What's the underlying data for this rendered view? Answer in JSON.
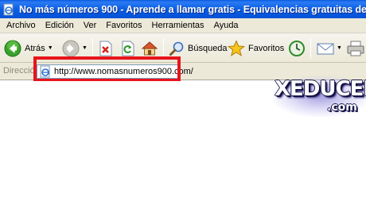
{
  "window": {
    "title": "No más números 900 - Aprende a llamar gratis - Equivalencias gratuitas de teléfo",
    "icon": "ie-page-icon"
  },
  "menu": {
    "items": [
      "Archivo",
      "Edición",
      "Ver",
      "Favoritos",
      "Herramientas",
      "Ayuda"
    ]
  },
  "toolbar": {
    "back_label": "Atrás",
    "search_label": "Búsqueda",
    "favorites_label": "Favoritos",
    "back_color": "#3a9a26"
  },
  "address": {
    "label": "Dirección",
    "url": "http://www.nomasnumeros900.com/",
    "highlight_color": "#e8141c"
  },
  "watermark": {
    "main": "XEDUCED",
    "sub": ".com",
    "glow_color": "#9e98de"
  }
}
